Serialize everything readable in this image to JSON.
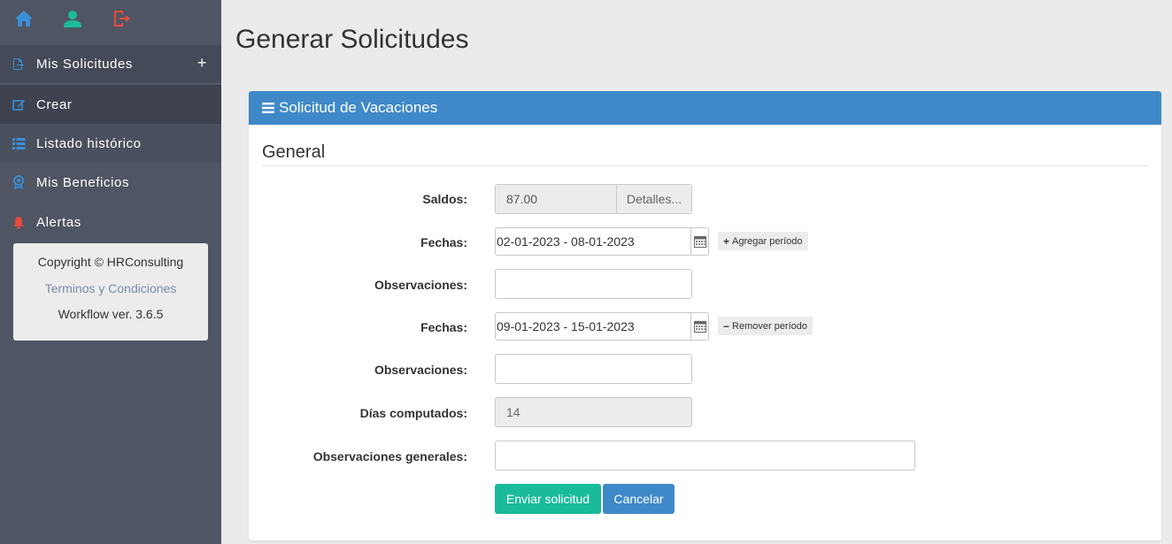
{
  "sidebar": {
    "top_icons": [
      {
        "name": "home-icon",
        "color": "#3a8fd9"
      },
      {
        "name": "user-icon",
        "color": "#1abb9c"
      },
      {
        "name": "logout-icon",
        "color": "#e74c3c"
      }
    ],
    "section": {
      "label": "Mis Solicitudes",
      "toggle": "+"
    },
    "items": [
      {
        "label": "Crear",
        "icon": "edit-icon"
      },
      {
        "label": "Listado histórico",
        "icon": "list-icon"
      },
      {
        "label": "Mis Beneficios",
        "icon": "award-icon"
      },
      {
        "label": "Alertas",
        "icon": "bell-icon"
      }
    ],
    "footer": {
      "copyright": "Copyright © HRConsulting",
      "terms_link": "Terminos y Condiciones",
      "version": "Workflow ver. 3.6.5"
    }
  },
  "page": {
    "title": "Generar Solicitudes"
  },
  "panel": {
    "heading": "Solicitud de Vacaciones",
    "section_title": "General",
    "form": {
      "saldos_label": "Saldos:",
      "saldos_value": "87.00",
      "detalles_button": "Detalles...",
      "periods": [
        {
          "fechas_label": "Fechas:",
          "range": "02-01-2023 - 08-01-2023",
          "action": "Agregar período",
          "action_symbol": "+",
          "obs_label": "Observaciones:",
          "obs_value": ""
        },
        {
          "fechas_label": "Fechas:",
          "range": "09-01-2023 - 15-01-2023",
          "action": "Remover período",
          "action_symbol": "−",
          "obs_label": "Observaciones:",
          "obs_value": ""
        }
      ],
      "dias_label": "Días computados:",
      "dias_value": "14",
      "obs_generales_label": "Observaciones generales:",
      "obs_generales_value": "",
      "submit_button": "Enviar solicitud",
      "cancel_button": "Cancelar"
    }
  },
  "colors": {
    "accent_blue": "#3f89c9",
    "accent_green": "#1abb9c",
    "sidebar_bg": "#4f5563"
  }
}
